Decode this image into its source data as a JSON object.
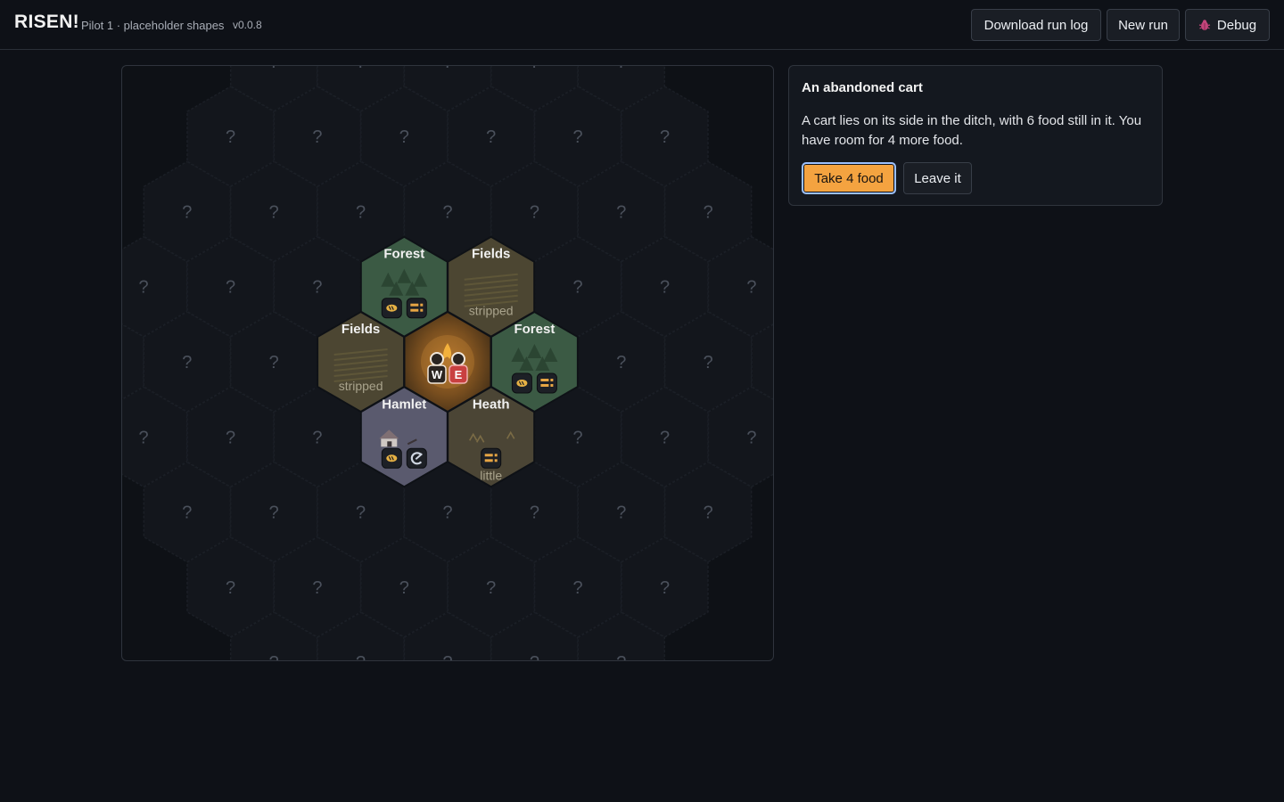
{
  "header": {
    "brand": "RISEN!",
    "subtitle": "Pilot 1 · placeholder shapes",
    "version": "v0.0.8",
    "download_label": "Download run log",
    "new_run_label": "New run",
    "debug_label": "Debug",
    "debug_icon": "bug-icon"
  },
  "map": {
    "unknown_symbol": "?",
    "party_tokens": [
      "W",
      "E"
    ],
    "tiles": [
      {
        "name": "Forest",
        "note": "",
        "terrain": "forest",
        "icons": [
          "food-icon",
          "supplies-icon"
        ]
      },
      {
        "name": "Fields",
        "note": "stripped",
        "terrain": "fields",
        "icons": []
      },
      {
        "name": "Fields",
        "note": "stripped",
        "terrain": "fields",
        "icons": []
      },
      {
        "name": "Forest",
        "note": "",
        "terrain": "forest",
        "icons": [
          "food-icon",
          "supplies-icon"
        ]
      },
      {
        "name": "Hamlet",
        "note": "",
        "terrain": "hamlet",
        "icons": [
          "food-icon",
          "repair-icon"
        ]
      },
      {
        "name": "Heath",
        "note": "little",
        "terrain": "heath",
        "icons": [
          "supplies-icon"
        ]
      }
    ],
    "colors": {
      "forest": "#3b5a44",
      "fields": "#4c4632",
      "hamlet": "#5a5a6e",
      "heath": "#4b4535",
      "camp": "#8a5a22",
      "unknown": "#13161c"
    }
  },
  "event": {
    "title": "An abandoned cart",
    "body": "A cart lies on its side in the ditch, with 6 food still in it. You have room for 4 more food.",
    "take_label": "Take 4 food",
    "leave_label": "Leave it"
  }
}
